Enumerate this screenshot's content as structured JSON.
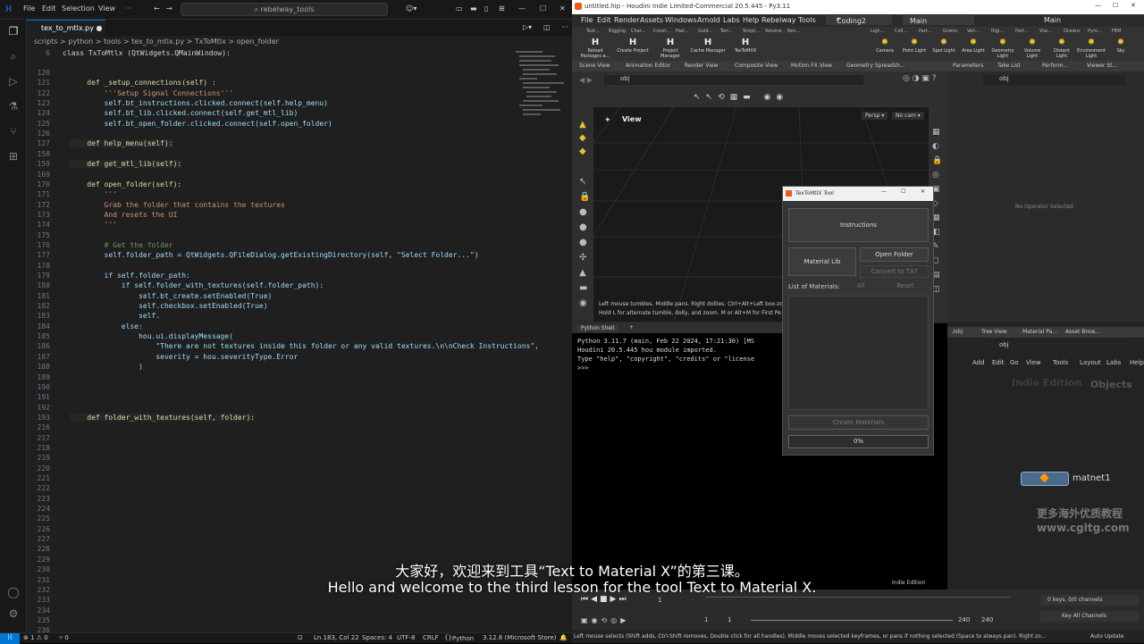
{
  "vscode": {
    "menu": [
      "File",
      "Edit",
      "Selection",
      "View"
    ],
    "search": "rebelway_tools",
    "tab": "tex_to_mtlx.py",
    "breadcrumb": "scripts > python > tools > tex_to_mtlx.py > TxToMtlx > open_folder",
    "sticky_line_no": "6",
    "sticky_line": "class TxToMtlx (QtWidgets.QMainWindow):",
    "lines": [
      {
        "n": "120",
        "t": ""
      },
      {
        "n": "121",
        "t": "    def _setup_connections(self) :"
      },
      {
        "n": "122",
        "t": "        '''Setup Signal Connections'''"
      },
      {
        "n": "123",
        "t": "        self.bt_instructions.clicked.connect(self.help_menu)"
      },
      {
        "n": "124",
        "t": "        self.bt_lib.clicked.connect(self.get_mtl_lib)"
      },
      {
        "n": "125",
        "t": "        self.bt_open_folder.clicked.connect(self.open_folder)"
      },
      {
        "n": "126",
        "t": ""
      },
      {
        "n": "127",
        "t": "    def help_menu(self):"
      },
      {
        "n": "158",
        "t": ""
      },
      {
        "n": "159",
        "t": "    def get_mtl_lib(self):"
      },
      {
        "n": "169",
        "t": ""
      },
      {
        "n": "170",
        "t": "    def open_folder(self):"
      },
      {
        "n": "171",
        "t": "        '''"
      },
      {
        "n": "172",
        "t": "        Grab the folder that contains the textures"
      },
      {
        "n": "173",
        "t": "        And resets the UI"
      },
      {
        "n": "174",
        "t": "        '''"
      },
      {
        "n": "175",
        "t": ""
      },
      {
        "n": "176",
        "t": "        # Get the folder"
      },
      {
        "n": "177",
        "t": "        self.folder_path = QtWidgets.QFileDialog.getExistingDirectory(self, \"Select Folder...\")"
      },
      {
        "n": "178",
        "t": ""
      },
      {
        "n": "179",
        "t": "        if self.folder_path:"
      },
      {
        "n": "180",
        "t": "            if self.folder_with_textures(self.folder_path):"
      },
      {
        "n": "181",
        "t": "                self.bt_create.setEnabled(True)"
      },
      {
        "n": "182",
        "t": "                self.checkbox.setEnabled(True)"
      },
      {
        "n": "183",
        "t": "                self."
      },
      {
        "n": "184",
        "t": "            else:"
      },
      {
        "n": "185",
        "t": "                hou.ui.displayMessage("
      },
      {
        "n": "186",
        "t": "                    \"There are not textures inside this folder or any valid textures.\\n\\nCheck Instructions\","
      },
      {
        "n": "187",
        "t": "                    severity = hou.severityType.Error"
      },
      {
        "n": "188",
        "t": "                )"
      },
      {
        "n": "189",
        "t": ""
      },
      {
        "n": "190",
        "t": ""
      },
      {
        "n": "191",
        "t": ""
      },
      {
        "n": "192",
        "t": ""
      },
      {
        "n": "193",
        "t": "    def folder_with_textures(self, folder):"
      },
      {
        "n": "216",
        "t": ""
      },
      {
        "n": "217",
        "t": ""
      },
      {
        "n": "218",
        "t": ""
      },
      {
        "n": "219",
        "t": ""
      },
      {
        "n": "220",
        "t": ""
      },
      {
        "n": "221",
        "t": ""
      },
      {
        "n": "222",
        "t": ""
      },
      {
        "n": "223",
        "t": ""
      },
      {
        "n": "224",
        "t": ""
      },
      {
        "n": "225",
        "t": ""
      },
      {
        "n": "226",
        "t": ""
      },
      {
        "n": "227",
        "t": ""
      },
      {
        "n": "228",
        "t": ""
      },
      {
        "n": "229",
        "t": ""
      },
      {
        "n": "230",
        "t": ""
      },
      {
        "n": "231",
        "t": ""
      },
      {
        "n": "232",
        "t": ""
      },
      {
        "n": "233",
        "t": ""
      },
      {
        "n": "234",
        "t": ""
      },
      {
        "n": "235",
        "t": ""
      },
      {
        "n": "236",
        "t": ""
      }
    ],
    "status": {
      "errors": "⊗ 1 ⚠ 0",
      "warnings": "⚠ 0",
      "pos": "Ln 183, Col 22",
      "spaces": "Spaces: 4",
      "enc": "UTF-8",
      "eol": "CRLF",
      "lang": "Python",
      "interp": "3.12.8 (Microsoft Store)"
    }
  },
  "houdini": {
    "title": "untitled.hip - Houdini Indie Limited-Commercial 20.5.445 - Py3.11",
    "menu": [
      "File",
      "Edit",
      "Render",
      "Assets",
      "Windows",
      "Arnold",
      "Labs",
      "Help",
      "Rebelway Tools"
    ],
    "desktop": "Coding2",
    "context": "Main",
    "context2": "Main",
    "shelf_tabs": [
      "Text...",
      "Rigging",
      "Char...",
      "Const...",
      "Hair...",
      "Guid...",
      "Terr...",
      "Simpl...",
      "Volume",
      "Ren..."
    ],
    "shelf_tabs2": [
      "Ligh...",
      "Coll...",
      "Part...",
      "Grains",
      "Vell...",
      "Rigi...",
      "Part...",
      "Visc...",
      "Oceans",
      "Pyro...",
      "FEM"
    ],
    "shelf_btns": [
      "Reload Packages a...",
      "Create Project",
      "Project Manager",
      "Cache Manager",
      "TexToMtlX"
    ],
    "shelf_btns2": [
      "Camera",
      "Point Light",
      "Spot Light",
      "Area Light",
      "Geometry Light",
      "Volume Light",
      "Distant Light",
      "Environment Light",
      "Sky"
    ],
    "vp_tabs": [
      "Scene View",
      "Animation Editor",
      "Render View",
      "Composite View",
      "Motion FX View",
      "Geometry Spreadsh..."
    ],
    "right_tabs": [
      "Parameters",
      "Take List",
      "Perform...",
      "Viewer St..."
    ],
    "path": "obj",
    "view_label": "View",
    "persp": "Persp",
    "cam": "No cam",
    "vp_hint1": "Left mouse tumbles. Middle pans. Right dollies. Ctrl+Alt+Left box-zo",
    "vp_hint2": "Hold L for alternate tumble, dolly, and zoom. M or Alt+M for First Pe",
    "no_op": "No Operator Selected",
    "shell_tab": "Python Shell",
    "shell": [
      "Python 3.11.7 (main, Feb 22 2024, 17:21:30) [MS",
      "Houdini 20.5.445 hou module imported.",
      "Type \"help\", \"copyright\", \"credits\" or \"license",
      "&gt;&gt;&gt;"
    ],
    "net_tabs": [
      "/obj",
      "Tree View",
      "Material Pa...",
      "Asset Brow..."
    ],
    "net_menu": [
      "Add",
      "Edit",
      "Go",
      "View",
      "Tools",
      "Layout",
      "Labs",
      "Help"
    ],
    "indie": "Indie Edition",
    "objects": "Objects",
    "node": "matnet1",
    "indie_ed": "Indie Edition",
    "frame_start": "1",
    "frame_cur": "1",
    "frame_end1": "240",
    "frame_end2": "240",
    "keys": "0 keys, 0/0 channels",
    "key_all": "Key All Channels",
    "auto_update": "Auto Update",
    "status": "Left mouse selects (Shift adds, Ctrl-Shift removes, Double click for all handles). Middle moves selected keyframes, or pans if nothing selected (Space to always pan). Right zo..."
  },
  "dialog": {
    "title": "TexToMtlX Tool",
    "instructions": "Instructions",
    "material_lib": "Material Lib",
    "open_folder": "Open Folder",
    "convert": "Convert to TX?",
    "list_label": "List of Materials:",
    "all": "All",
    "reset": "Reset",
    "create": "Create Materials",
    "progress": "0%"
  },
  "subtitles": {
    "zh": "大家好，欢迎来到工具“Text to Material X”的第三课。",
    "en": "Hello and welcome to the third lesson for the tool Text to Material X."
  },
  "watermark": {
    "a": "更多海外优质教程",
    "b": "www.cgltg.com"
  }
}
